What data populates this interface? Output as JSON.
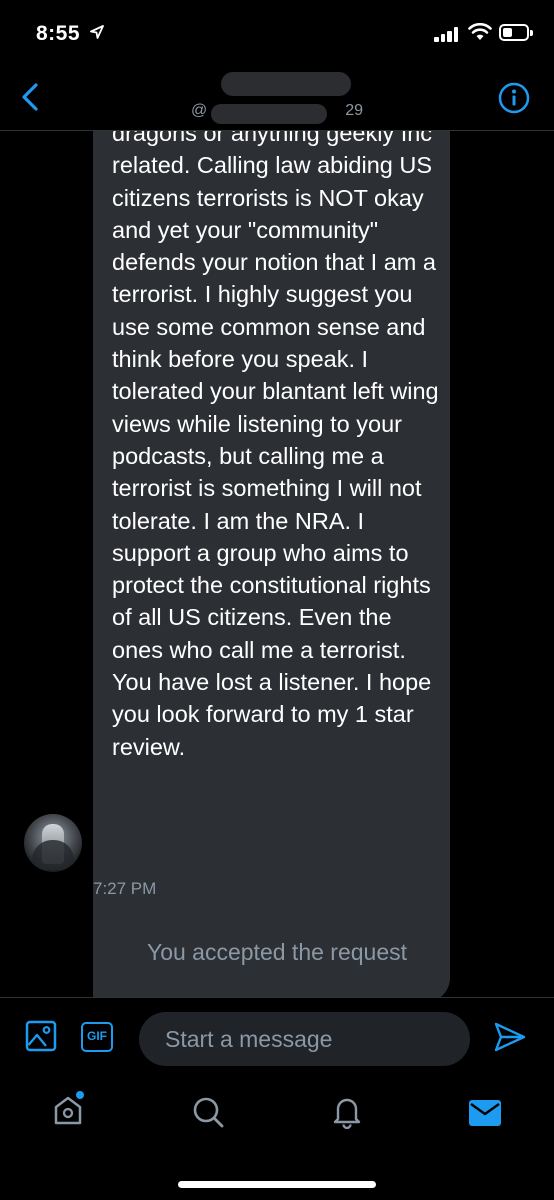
{
  "status_bar": {
    "time": "8:55"
  },
  "header": {
    "handle": "@",
    "handle_suffix": "29"
  },
  "message": {
    "text": "dragons or anything geekly Inc related.  Calling law abiding US citizens terrorists is NOT okay and yet your \"community\" defends your notion that I am a terrorist. I highly suggest you use some common sense and think before you speak. I tolerated your blantant left wing views while listening to your podcasts, but calling me a terrorist is something I will not tolerate. I am the NRA. I support a group who aims to protect the constitutional rights of all US citizens. Even the ones who call me a terrorist. You have lost a listener. I hope you look forward to my 1 star review.",
    "timestamp": "7:27 PM"
  },
  "system_message": "You accepted the request",
  "composer": {
    "gif_label": "GIF",
    "placeholder": "Start a message"
  },
  "colors": {
    "accent": "#1d9bf0",
    "bubble": "#2c2f34",
    "muted": "#8b98a5",
    "background": "#000000"
  },
  "icons": {
    "back": "chevron-left-icon",
    "info": "info-icon",
    "image": "image-icon",
    "send": "send-icon",
    "home": "home-icon",
    "search": "search-icon",
    "notifications": "bell-icon",
    "messages": "mail-icon"
  }
}
